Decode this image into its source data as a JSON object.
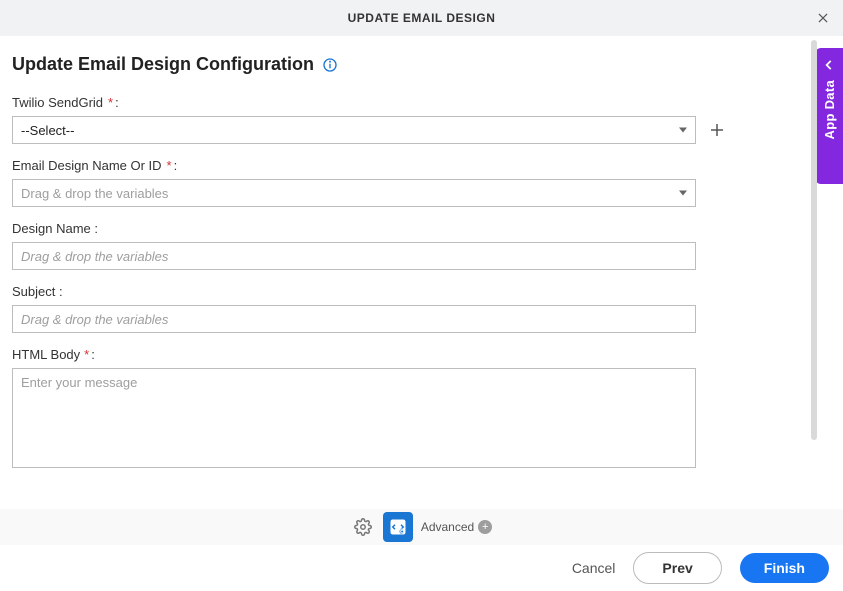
{
  "titlebar": {
    "title": "UPDATE EMAIL DESIGN"
  },
  "heading": {
    "text": "Update Email Design Configuration"
  },
  "fields": {
    "sendgrid": {
      "label": "Twilio SendGrid",
      "required_marker": "*",
      "colon": ":",
      "selected": "--Select--"
    },
    "design_id": {
      "label": "Email Design Name Or ID ",
      "required_marker": "*",
      "colon": " :",
      "placeholder": "Drag & drop the variables"
    },
    "design_name": {
      "label": "Design Name :",
      "placeholder": "Drag & drop the variables"
    },
    "subject": {
      "label": "Subject :",
      "placeholder": "Drag & drop the variables"
    },
    "html_body": {
      "label": "HTML Body",
      "required_marker": "*",
      "colon": ":",
      "placeholder": "Enter your message"
    }
  },
  "footer": {
    "advanced_label": "Advanced"
  },
  "buttons": {
    "cancel": "Cancel",
    "prev": "Prev",
    "finish": "Finish"
  },
  "side_tab": {
    "label": "App Data"
  }
}
